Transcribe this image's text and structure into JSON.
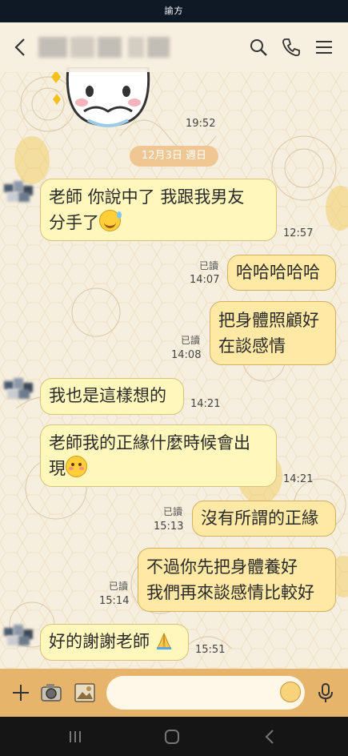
{
  "status_bar": {
    "title": "諭方"
  },
  "header": {
    "back_icon": "chevron-left-icon",
    "contact_name_pixelated": true,
    "actions": [
      "search-icon",
      "phone-icon",
      "menu-icon"
    ]
  },
  "chat": {
    "top_sticker_time": "19:52",
    "date_separator": "12月3日 週日",
    "messages": [
      {
        "from": "them",
        "line1": "老師 你說中了 我跟我男友",
        "line2": "分手了",
        "emoji": "sweat-smile",
        "time": "12:57"
      },
      {
        "from": "me",
        "text": "哈哈哈哈哈",
        "read": "已讀",
        "time": "14:07"
      },
      {
        "from": "me",
        "line1": "把身體照顧好",
        "line2": "在談感情",
        "read": "已讀",
        "time": "14:08"
      },
      {
        "from": "them",
        "text": "我也是這樣想的",
        "time": "14:21"
      },
      {
        "from": "them",
        "line1": "老師我的正緣什麼時候會出",
        "line2": "現",
        "emoji": "blush",
        "time": "14:21"
      },
      {
        "from": "me",
        "text": "沒有所謂的正緣",
        "read": "已讀",
        "time": "15:13"
      },
      {
        "from": "me",
        "line1": "不過你先把身體養好",
        "line2": "我們再來談感情比較好",
        "read": "已讀",
        "time": "15:14"
      },
      {
        "from": "them",
        "text": "好的謝謝老師",
        "emoji": "pray",
        "time": "15:51"
      }
    ]
  },
  "input_bar": {
    "icons": [
      "plus-icon",
      "camera-icon",
      "photo-icon",
      "sticker-icon",
      "microphone-icon"
    ],
    "placeholder": ""
  },
  "nav_bar": {
    "buttons": [
      "recent-apps-icon",
      "home-icon",
      "back-icon"
    ]
  },
  "colors": {
    "header_bg": "#f6efdf",
    "bubble_them": "#fff7bc",
    "bubble_me": "#ffe9a4",
    "input_bar": "#e7b46b",
    "date_pill": "#f0c793"
  }
}
